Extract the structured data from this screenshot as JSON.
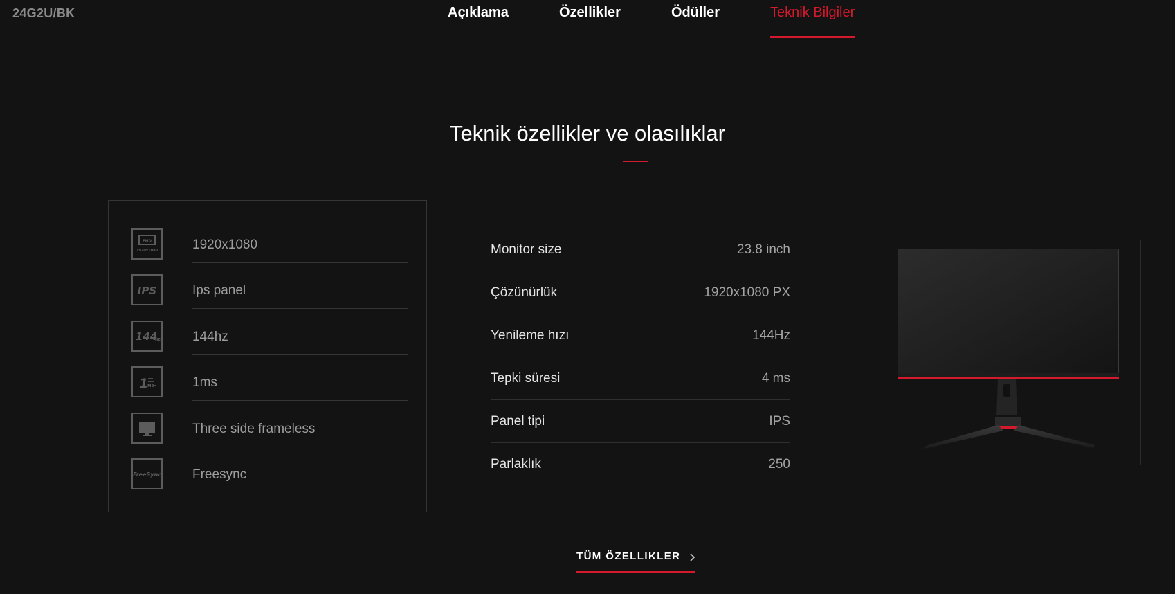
{
  "header": {
    "model": "24G2U/BK",
    "tabs": [
      {
        "label": "Açıklama"
      },
      {
        "label": "Özellikler"
      },
      {
        "label": "Ödüller"
      },
      {
        "label": "Teknik Bilgiler",
        "active": true
      }
    ]
  },
  "section": {
    "title": "Teknik özellikler ve olasılıklar"
  },
  "features": [
    {
      "icon": "fhd-resolution-icon",
      "label": "1920x1080"
    },
    {
      "icon": "ips-icon",
      "label": "Ips panel"
    },
    {
      "icon": "144hz-icon",
      "label": "144hz"
    },
    {
      "icon": "1ms-icon",
      "label": "1ms"
    },
    {
      "icon": "frameless-monitor-icon",
      "label": "Three side frameless"
    },
    {
      "icon": "freesync-icon",
      "label": "Freesync"
    }
  ],
  "specs": [
    {
      "key": "Monitor size",
      "value": "23.8 inch"
    },
    {
      "key": "Çözünürlük",
      "value": "1920x1080 PX"
    },
    {
      "key": "Yenileme hızı",
      "value": "144Hz"
    },
    {
      "key": "Tepki süresi",
      "value": "4 ms"
    },
    {
      "key": "Panel tipi",
      "value": "IPS"
    },
    {
      "key": "Parlaklık",
      "value": "250"
    }
  ],
  "cta": {
    "label": "TÜM ÖZELLIKLER"
  },
  "colors": {
    "accent": "#d5192d",
    "background": "#131313"
  }
}
